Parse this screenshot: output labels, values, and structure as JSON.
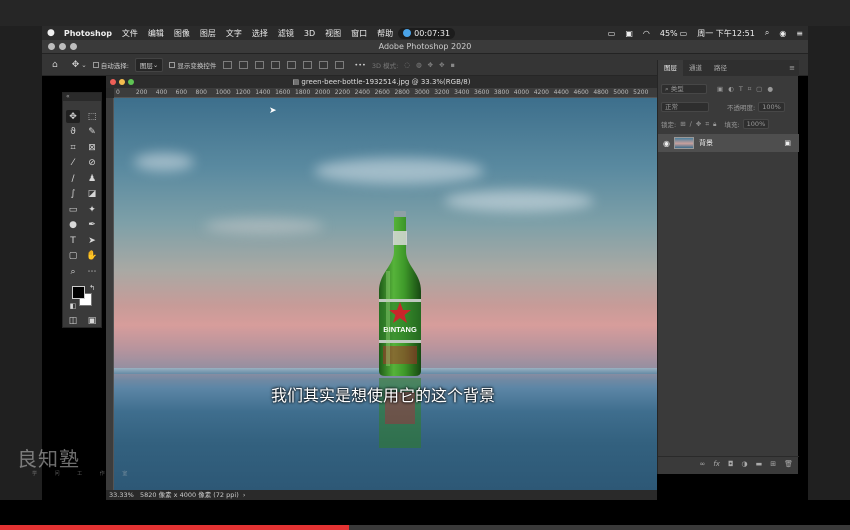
{
  "menubar": {
    "apple": "",
    "app": "Photoshop",
    "items": [
      "文件",
      "编辑",
      "图像",
      "图层",
      "文字",
      "选择",
      "滤镜",
      "3D",
      "视图",
      "窗口",
      "帮助"
    ],
    "recording_time": "00:07:31",
    "battery": "45%",
    "clock": "周一 下午12:51"
  },
  "window": {
    "title": "Adobe Photoshop 2020"
  },
  "options_bar": {
    "auto_select_label": "自动选择:",
    "auto_select_value": "图层",
    "show_transform_label": "显示变换控件",
    "mode_3d_label": "3D 模式:"
  },
  "toolbox": {
    "header": "«"
  },
  "document": {
    "tab_title": "green-beer-bottle-1932514.jpg @ 33.3%(RGB/8)",
    "ruler_ticks": [
      "0",
      "200",
      "400",
      "600",
      "800",
      "1000",
      "1200",
      "1400",
      "1600",
      "1800",
      "2000",
      "2200",
      "2400",
      "2600",
      "2800",
      "3000",
      "3200",
      "3400",
      "3600",
      "3800",
      "4000",
      "4200",
      "4400",
      "4600",
      "4800",
      "5000",
      "5200"
    ],
    "status_zoom": "33.33%",
    "status_info": "5820 像素 x 4000 像素 (72 ppi)",
    "bottle_label": "BINTANG"
  },
  "layers_panel": {
    "tabs": [
      "图层",
      "通道",
      "路径"
    ],
    "search_placeholder": "类型",
    "blend_mode": "正常",
    "opacity_label": "不透明度:",
    "opacity_value": "100%",
    "lock_label": "锁定:",
    "fill_label": "填充:",
    "fill_value": "100%",
    "layer_name": "背景",
    "footer_icons": [
      "link-icon",
      "fx-icon",
      "mask-icon",
      "adjustment-icon",
      "folder-icon",
      "new-layer-icon",
      "trash-icon"
    ],
    "footer_fx": "fx"
  },
  "subtitle": "我们其实是想使用它的这个背景",
  "watermark": {
    "text": "良知塾",
    "sub": "学 问 工 作 室"
  },
  "video": {
    "progress": 0.41
  },
  "colors": {
    "progress": "#e33333",
    "accent": "#4aa3e8"
  }
}
